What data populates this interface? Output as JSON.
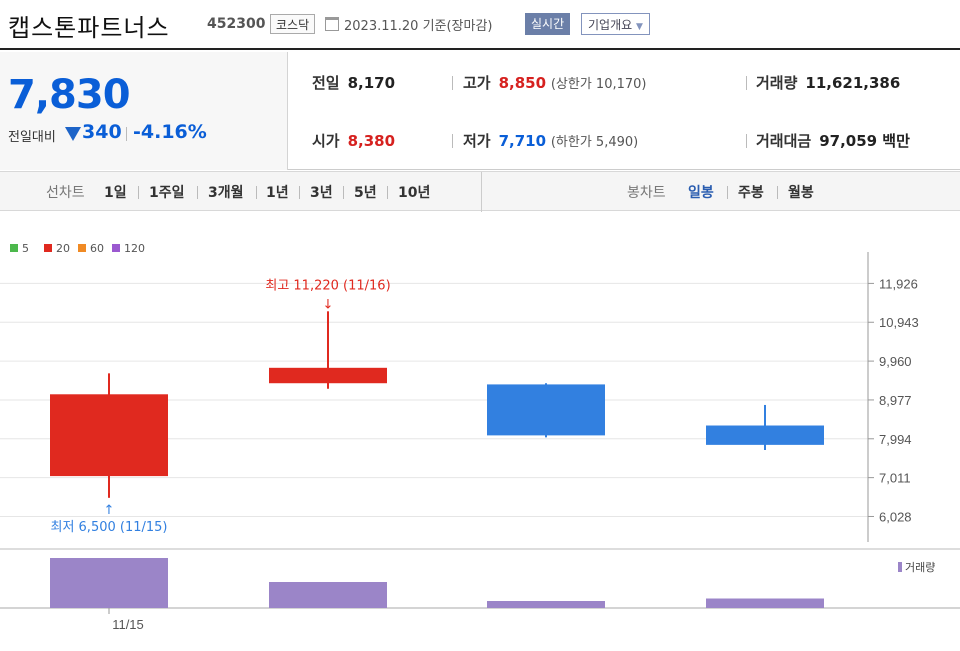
{
  "header": {
    "company": "캡스톤파트너스",
    "code": "452300",
    "market": "코스닥",
    "date": "2023.11.20 기준(장마감)",
    "realtime": "실시간",
    "overview": "기업개요"
  },
  "quote": {
    "price": "7,830",
    "change_label": "전일대비",
    "change": "340",
    "change_pct": "-4.16%",
    "prev_label": "전일",
    "prev": "8,170",
    "high_label": "고가",
    "high": "8,850",
    "upper_limit": "(상한가 10,170)",
    "volume_label": "거래량",
    "volume": "11,621,386",
    "open_label": "시가",
    "open": "8,380",
    "low_label": "저가",
    "low": "7,710",
    "lower_limit": "(하한가 5,490)",
    "amount_label": "거래대금",
    "amount": "97,059 백만"
  },
  "periods": {
    "line_label": "선차트",
    "line": [
      "1일",
      "1주일",
      "3개월",
      "1년",
      "3년",
      "5년",
      "10년"
    ],
    "candle_label": "봉차트",
    "candle": [
      "일봉",
      "주봉",
      "월봉"
    ],
    "active_candle": "일봉"
  },
  "colors": {
    "up": "#e0291f",
    "down": "#3280e0",
    "volume": "#9b85c8",
    "ma5": "#4cb84c",
    "ma20": "#e0291f",
    "ma60": "#f08a24",
    "ma120": "#9b59d0"
  },
  "chart_data": {
    "type": "candlestick",
    "legend": [
      "5",
      "20",
      "60",
      "120"
    ],
    "y_ticks": [
      "11,926",
      "10,943",
      "9,960",
      "8,977",
      "7,994",
      "7,011",
      "6,028"
    ],
    "ylim": [
      5534,
      12417
    ],
    "x_labels": [
      "11/15"
    ],
    "candles": [
      {
        "open": 7050,
        "close": 9120,
        "high": 9650,
        "low": 6500
      },
      {
        "open": 9400,
        "close": 9790,
        "high": 11220,
        "low": 9260
      },
      {
        "open": 9370,
        "close": 8080,
        "high": 9400,
        "low": 8030
      },
      {
        "open": 8330,
        "close": 7840,
        "high": 8850,
        "low": 7710
      }
    ],
    "volume": [
      1.0,
      0.52,
      0.14,
      0.19
    ],
    "volume_label": "거래량",
    "max_annotation": "최고 11,220 (11/16)",
    "min_annotation": "최저 6,500 (11/15)"
  }
}
